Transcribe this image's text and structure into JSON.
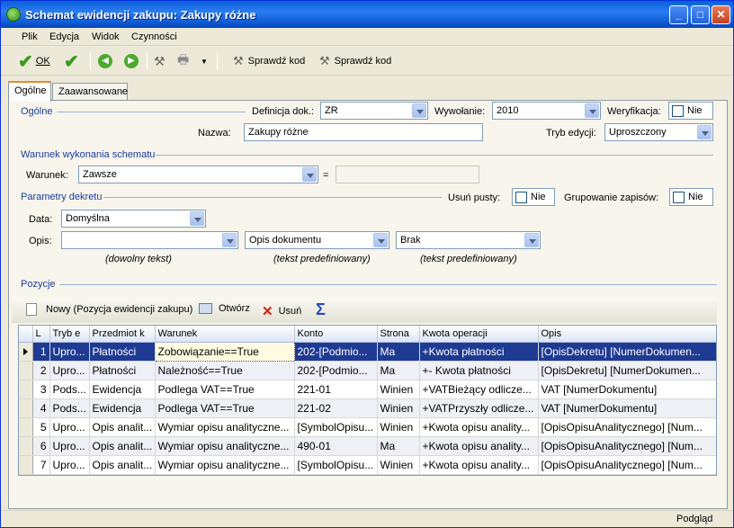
{
  "window": {
    "title": "Schemat ewidencji zakupu: Zakupy różne"
  },
  "menu": [
    "Plik",
    "Edycja",
    "Widok",
    "Czynności"
  ],
  "toolbar": {
    "ok_label": "OK",
    "check_code_1": "Sprawdź kod",
    "check_code_2": "Sprawdź kod"
  },
  "tabs": [
    "Ogólne",
    "Zaawansowane"
  ],
  "general": {
    "section_label": "Ogólne",
    "definition_label": "Definicja dok.:",
    "definition_value": "ZR",
    "call_label": "Wywołanie:",
    "call_value": "2010",
    "verification_label": "Weryfikacja:",
    "verification_value": "Nie",
    "name_label": "Nazwa:",
    "name_value": "Zakupy różne",
    "edit_mode_label": "Tryb edycji:",
    "edit_mode_value": "Uproszczony"
  },
  "condition": {
    "section_label": "Warunek wykonania schematu",
    "condition_label": "Warunek:",
    "condition_value": "Zawsze",
    "equals": "="
  },
  "decree": {
    "section_label": "Parametry dekretu",
    "remove_empty_label": "Usuń pusty:",
    "remove_empty_value": "Nie",
    "grouping_label": "Grupowanie zapisów:",
    "grouping_value": "Nie",
    "date_label": "Data:",
    "date_value": "Domyślna",
    "desc_label": "Opis:",
    "desc_value_1": "",
    "desc_value_2": "Opis dokumentu",
    "desc_value_3": "Brak",
    "hint_1": "(dowolny tekst)",
    "hint_2": "(tekst predefiniowany)",
    "hint_3": "(tekst predefiniowany)"
  },
  "positions": {
    "section_label": "Pozycje",
    "new_label": "Nowy (Pozycja ewidencji zakupu)",
    "open_label": "Otwórz",
    "delete_label": "Usuń",
    "sum_icon": "sigma-icon"
  },
  "grid": {
    "columns": [
      "L",
      "Tryb e",
      "Przedmiot k",
      "Warunek",
      "Konto",
      "Strona",
      "Kwota operacji",
      "Opis"
    ],
    "rows": [
      [
        "1",
        "Upro...",
        "Płatności",
        "Zobowiązanie==True",
        "202-[Podmio...",
        "Ma",
        "+Kwota płatności",
        "[OpisDekretu] [NumerDokumen..."
      ],
      [
        "2",
        "Upro...",
        "Płatności",
        "Należność==True",
        "202-[Podmio...",
        "Ma",
        "+- Kwota płatności",
        "[OpisDekretu] [NumerDokumen..."
      ],
      [
        "3",
        "Pods...",
        "Ewidencja",
        "Podlega VAT==True",
        "221-01",
        "Winien",
        "+VATBieżący odlicze...",
        "VAT [NumerDokumentu]"
      ],
      [
        "4",
        "Pods...",
        "Ewidencja",
        "Podlega VAT==True",
        "221-02",
        "Winien",
        "+VATPrzyszły odlicze...",
        "VAT [NumerDokumentu]"
      ],
      [
        "5",
        "Upro...",
        "Opis analit...",
        "Wymiar opisu analityczne...",
        "[SymbolOpisu...",
        "Winien",
        "+Kwota opisu anality...",
        "[OpisOpisuAnalitycznego] [Num..."
      ],
      [
        "6",
        "Upro...",
        "Opis analit...",
        "Wymiar opisu analityczne...",
        "490-01",
        "Ma",
        "+Kwota opisu anality...",
        "[OpisOpisuAnalitycznego] [Num..."
      ],
      [
        "7",
        "Upro...",
        "Opis analit...",
        "Wymiar opisu analityczne...",
        "[SymbolOpisu...",
        "Winien",
        "+Kwota opisu anality...",
        "[OpisOpisuAnalitycznego] [Num..."
      ]
    ]
  },
  "status": {
    "text": "Podgląd"
  }
}
